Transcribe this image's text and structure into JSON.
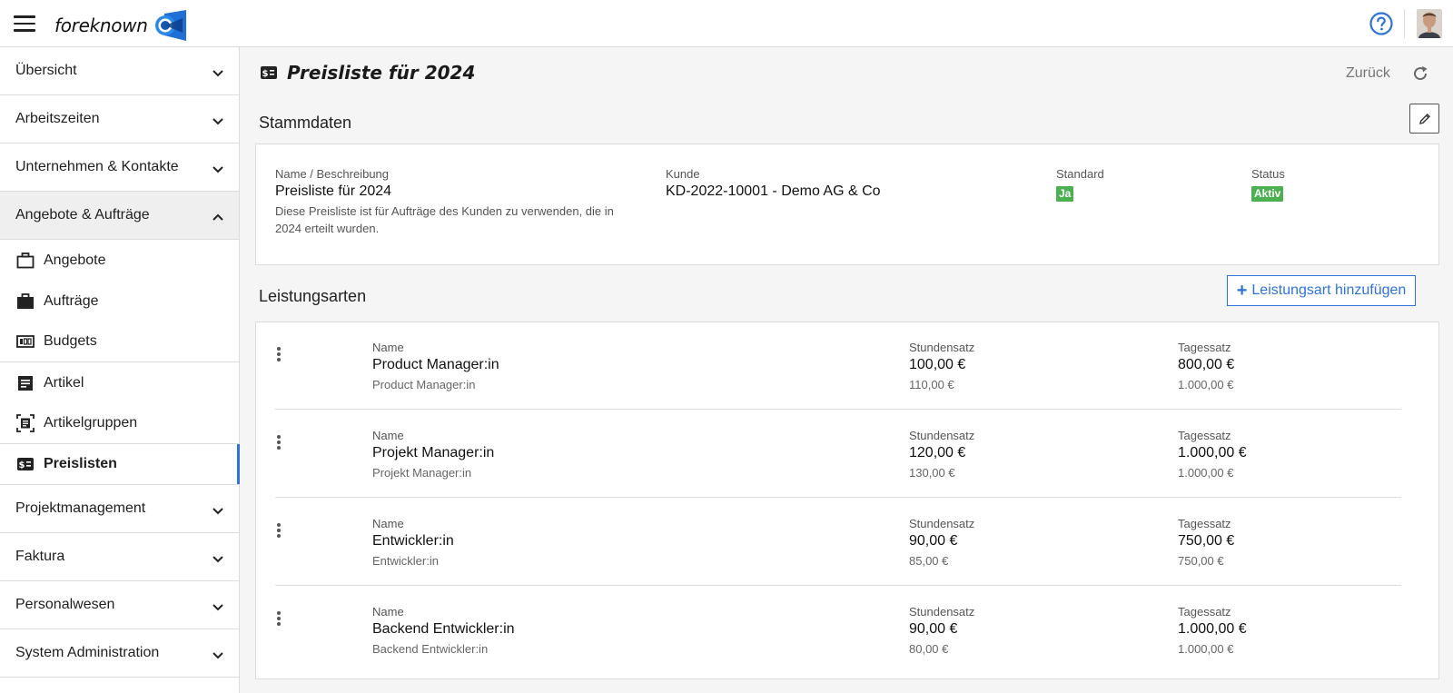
{
  "topbar": {
    "logo_text": "foreknown"
  },
  "sidebar": {
    "groups_top": [
      {
        "label": "Übersicht"
      },
      {
        "label": "Arbeitszeiten"
      },
      {
        "label": "Unternehmen & Kontakte"
      },
      {
        "label": "Angebote & Aufträge",
        "open": true
      }
    ],
    "items": [
      {
        "label": "Angebote",
        "icon": "briefcase-outline-icon"
      },
      {
        "label": "Aufträge",
        "icon": "briefcase-icon"
      },
      {
        "label": "Budgets",
        "icon": "budget-counter-icon"
      },
      {
        "label": "Artikel",
        "icon": "document-list-icon"
      },
      {
        "label": "Artikelgruppen",
        "icon": "article-group-icon"
      },
      {
        "label": "Preislisten",
        "icon": "price-list-icon",
        "active": true
      }
    ],
    "groups_bottom": [
      {
        "label": "Projektmanagement"
      },
      {
        "label": "Faktura"
      },
      {
        "label": "Personalwesen"
      },
      {
        "label": "System Administration"
      }
    ]
  },
  "page": {
    "title": "Preisliste für 2024",
    "back_label": "Zurück"
  },
  "stammdaten": {
    "section_title": "Stammdaten",
    "name_label": "Name / Beschreibung",
    "name_value": "Preisliste für 2024",
    "description": "Diese Preisliste ist für Aufträge des Kunden zu verwenden, die in 2024 erteilt wurden.",
    "kunde_label": "Kunde",
    "kunde_value": "KD-2022-10001 - Demo AG & Co",
    "standard_label": "Standard",
    "standard_value": "Ja",
    "status_label": "Status",
    "status_value": "Aktiv",
    "badge_color": "#4caf50"
  },
  "leistungsarten": {
    "section_title": "Leistungsarten",
    "add_label": "Leistungsart hinzufügen",
    "col_name": "Name",
    "col_stundensatz": "Stundensatz",
    "col_tagessatz": "Tagessatz",
    "rows": [
      {
        "name": "Product Manager:in",
        "name_sub": "Product Manager:in",
        "stundensatz": "100,00 €",
        "stundensatz_sub": "110,00 €",
        "tagessatz": "800,00 €",
        "tagessatz_sub": "1.000,00 €"
      },
      {
        "name": "Projekt Manager:in",
        "name_sub": "Projekt Manager:in",
        "stundensatz": "120,00 €",
        "stundensatz_sub": "130,00 €",
        "tagessatz": "1.000,00 €",
        "tagessatz_sub": "1.000,00 €"
      },
      {
        "name": "Entwickler:in",
        "name_sub": "Entwickler:in",
        "stundensatz": "90,00 €",
        "stundensatz_sub": "85,00 €",
        "tagessatz": "750,00 €",
        "tagessatz_sub": "750,00 €"
      },
      {
        "name": "Backend Entwickler:in",
        "name_sub": "Backend Entwickler:in",
        "stundensatz": "90,00 €",
        "stundensatz_sub": "80,00 €",
        "tagessatz": "1.000,00 €",
        "tagessatz_sub": "1.000,00 €"
      }
    ]
  },
  "colors": {
    "accent": "#2f73d8",
    "logo_blue": "#1f6fd6"
  }
}
